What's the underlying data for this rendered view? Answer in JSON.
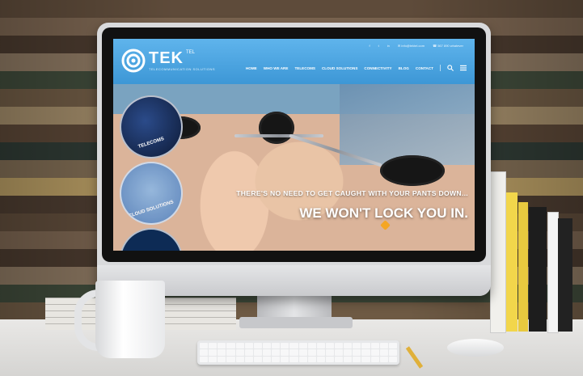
{
  "site": {
    "logo_text": "TEK",
    "logo_sup": "TEL",
    "logo_tagline": "TELECOMMUNICATION SOLUTIONS",
    "top_contact": [
      "f",
      "t",
      "in",
      "✉ info@tektel.com",
      "☎ 567 890 whatever"
    ],
    "nav": [
      "HOME",
      "WHO WE ARE",
      "TELECOMS",
      "CLOUD SOLUTIONS",
      "CONNECTIVITY",
      "BLOG",
      "CONTACT"
    ],
    "hero": {
      "line1": "THERE'S NO NEED TO GET CAUGHT WITH YOUR PANTS DOWN...",
      "line2": "WE WON'T LOCK YOU IN."
    },
    "circles": [
      "TELECOMS",
      "CLOUD SOLUTIONS"
    ]
  },
  "colors": {
    "header_blue": "#3d97d6",
    "accent_orange": "#f5a623"
  }
}
